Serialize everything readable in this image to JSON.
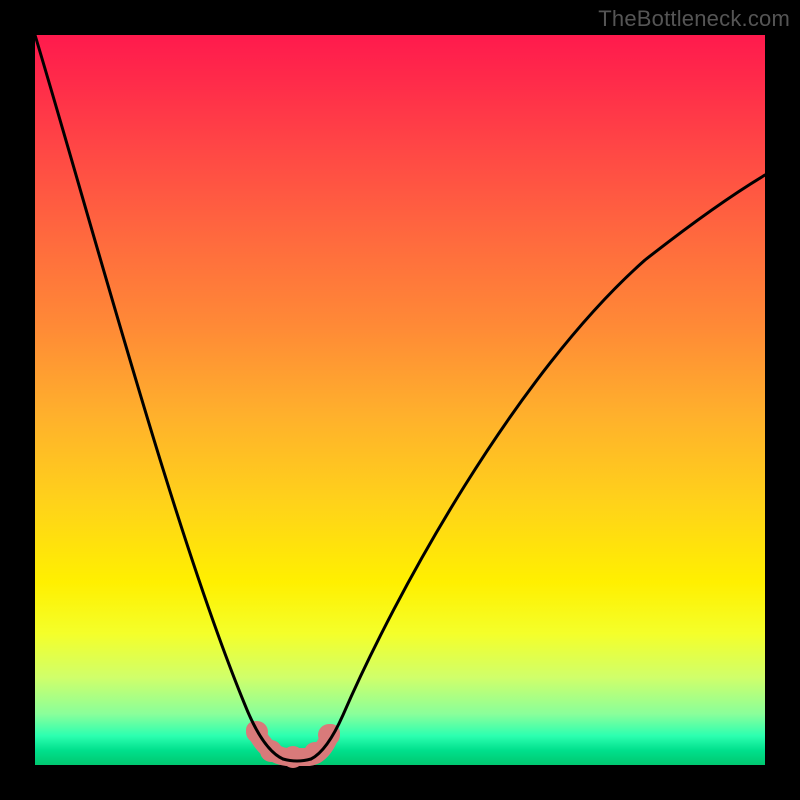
{
  "watermark": "TheBottleneck.com",
  "chart_data": {
    "type": "line",
    "title": "",
    "xlabel": "",
    "ylabel": "",
    "xlim": [
      0,
      100
    ],
    "ylim": [
      0,
      100
    ],
    "grid": false,
    "legend": false,
    "series": [
      {
        "name": "left-branch",
        "x": [
          0,
          4,
          8,
          12,
          16,
          20,
          24,
          28,
          31,
          33
        ],
        "y": [
          100,
          87,
          74,
          61,
          48,
          36,
          24,
          13,
          5,
          2
        ]
      },
      {
        "name": "valley",
        "x": [
          33,
          35,
          37.5,
          39.5
        ],
        "y": [
          2,
          0,
          0,
          2
        ]
      },
      {
        "name": "right-branch",
        "x": [
          39.5,
          42,
          46,
          50,
          55,
          60,
          66,
          73,
          80,
          88,
          96,
          100
        ],
        "y": [
          2,
          7,
          16,
          25,
          35,
          44,
          53,
          61,
          68,
          74,
          79,
          81
        ]
      },
      {
        "name": "valley-highlight-dots",
        "x": [
          31,
          32.5,
          34.5,
          36.5,
          38.5,
          39.5
        ],
        "y": [
          4.5,
          2.5,
          1,
          1,
          2,
          4
        ]
      }
    ],
    "colors": {
      "curve": "#000000",
      "highlight": "#d97a7a"
    }
  }
}
